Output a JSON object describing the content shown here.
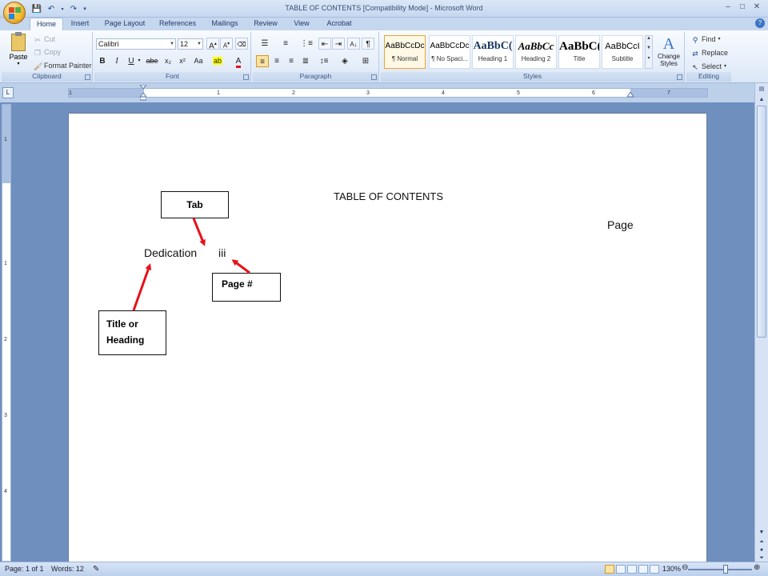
{
  "window": {
    "title": "TABLE OF CONTENTS [Compatibility Mode] - Microsoft Word",
    "controls": [
      "–",
      "□",
      "✕"
    ]
  },
  "tabs": [
    "Home",
    "Insert",
    "Page Layout",
    "References",
    "Mailings",
    "Review",
    "View",
    "Acrobat"
  ],
  "ribbon": {
    "clipboard": {
      "paste": "Paste",
      "cut": "Cut",
      "copy": "Copy",
      "format_painter": "Format Painter",
      "label": "Clipboard"
    },
    "font": {
      "name": "Calibri",
      "size": "12",
      "label": "Font",
      "buttons": [
        "B",
        "I",
        "U",
        "abe",
        "x₂",
        "x²",
        "Aa"
      ]
    },
    "paragraph": {
      "label": "Paragraph"
    },
    "styles": {
      "label": "Styles",
      "tiles": [
        {
          "sample": "AaBbCcDc",
          "name": "¶ Normal"
        },
        {
          "sample": "AaBbCcDc",
          "name": "¶ No Spaci..."
        },
        {
          "sample": "AaBbC(",
          "name": "Heading 1"
        },
        {
          "sample": "AaBbCc",
          "name": "Heading 2"
        },
        {
          "sample": "AaBbC(",
          "name": "Title"
        },
        {
          "sample": "AaBbCcI",
          "name": "Subtitle"
        }
      ],
      "change_styles": "Change Styles"
    },
    "editing": {
      "label": "Editing",
      "find": "Find",
      "replace": "Replace",
      "select": "Select"
    }
  },
  "ruler_numbers": [
    "1",
    "1",
    "2",
    "3",
    "4",
    "5",
    "6",
    "7"
  ],
  "vruler_numbers": [
    "1",
    "1",
    "2",
    "3",
    "4"
  ],
  "document": {
    "heading": "TABLE OF CONTENTS",
    "page_col": "Page",
    "entry_title": "Dedication",
    "entry_page": "iii"
  },
  "callouts": {
    "tab": "Tab",
    "page_num": "Page #",
    "title_heading_1": "Title or",
    "title_heading_2": "Heading"
  },
  "status": {
    "page": "Page: 1 of 1",
    "words": "Words: 12",
    "zoom": "130%"
  },
  "colors": {
    "arrow": "#e8111a",
    "accent": "#e3a63a"
  }
}
